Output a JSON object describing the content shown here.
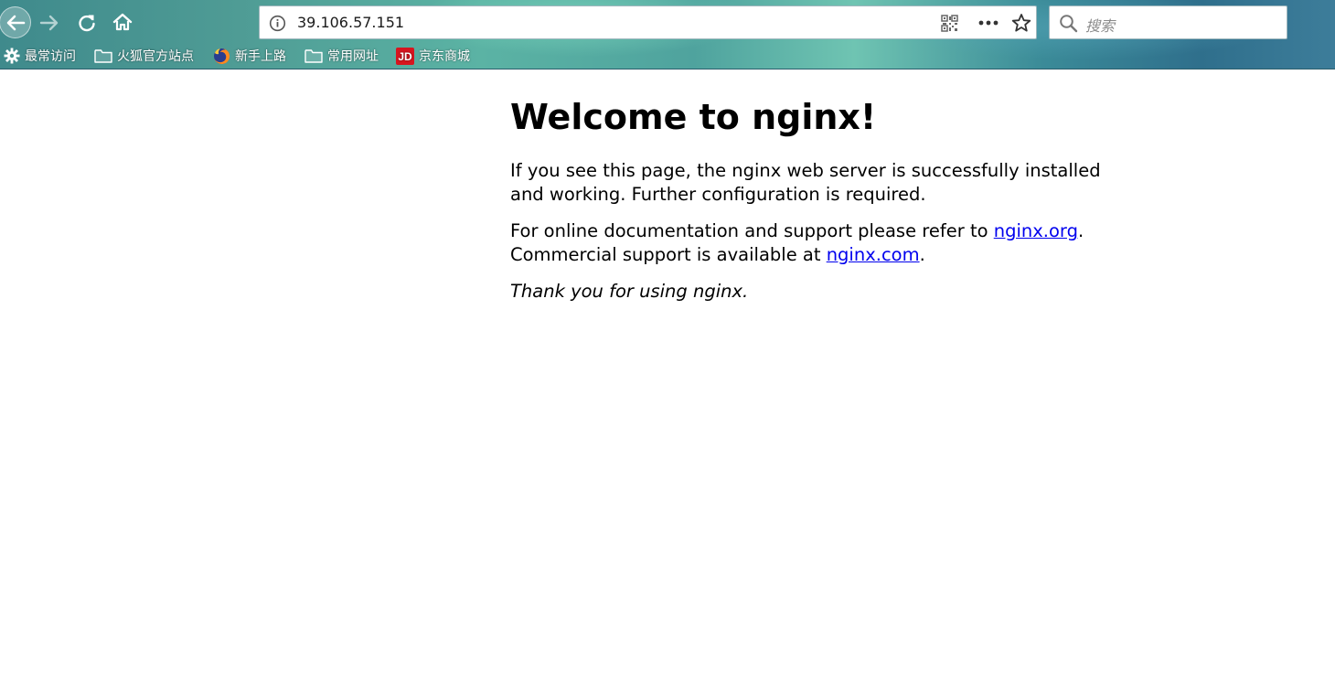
{
  "browser": {
    "url": "39.106.57.151",
    "search_placeholder": "搜索",
    "bookmarks": [
      {
        "label": "最常访问",
        "icon": "gear-icon"
      },
      {
        "label": "火狐官方站点",
        "icon": "folder-icon"
      },
      {
        "label": "新手上路",
        "icon": "firefox-icon"
      },
      {
        "label": "常用网址",
        "icon": "folder-icon"
      },
      {
        "label": "京东商城",
        "icon": "jd-icon"
      }
    ],
    "jd_badge": "JD"
  },
  "page": {
    "title": "Welcome to nginx!",
    "para1": "If you see this page, the nginx web server is successfully installed and working. Further configuration is required.",
    "para2_prefix": "For online documentation and support please refer to ",
    "link_org": "nginx.org",
    "para2_mid": ".",
    "para2_line2_prefix": "Commercial support is available at ",
    "link_com": "nginx.com",
    "para2_end": ".",
    "thanks": "Thank you for using nginx."
  },
  "colors": {
    "link": "#0000ee",
    "text": "#000000",
    "chrome_accent": "#4f9c95"
  }
}
